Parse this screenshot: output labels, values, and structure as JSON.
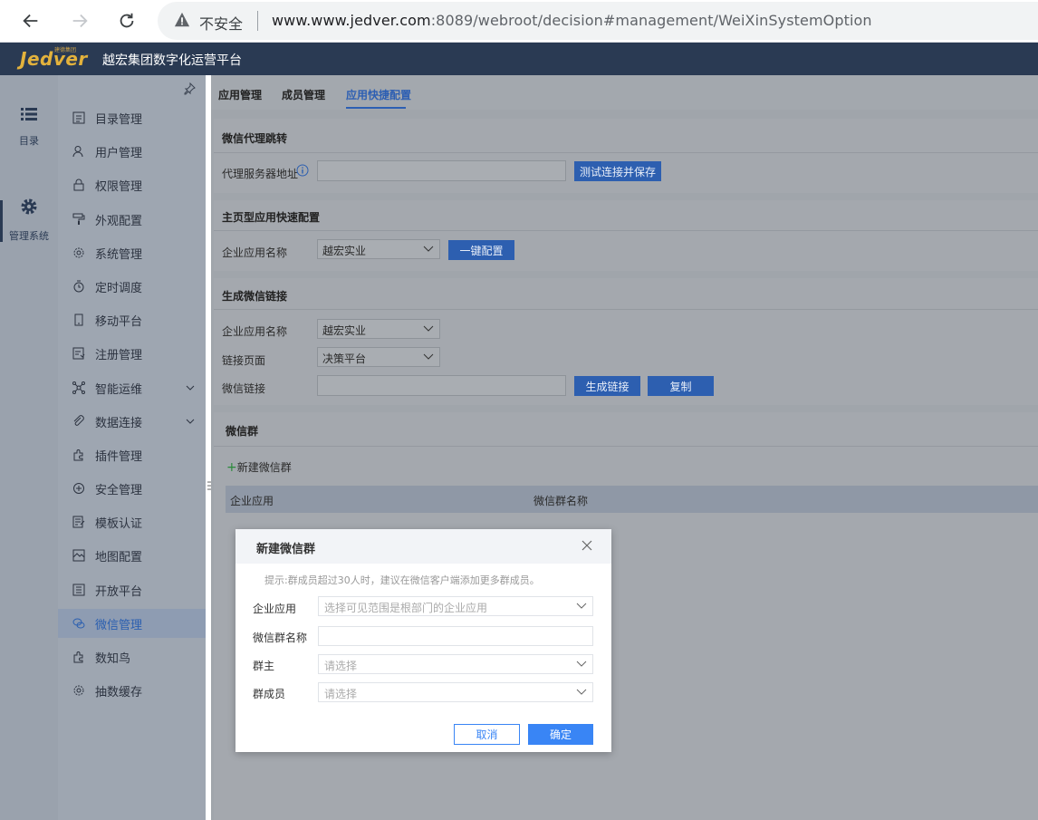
{
  "browser": {
    "insecure_label": "不安全",
    "url_host": "www.www.jedver.com",
    "url_rest": ":8089/webroot/decision#management/WeiXinSystemOption"
  },
  "app": {
    "logo": "Jedver",
    "logo_sub": "建德集团",
    "title": "越宏集团数字化运营平台"
  },
  "rail": {
    "items": [
      {
        "label": "目录",
        "icon": "list-icon"
      },
      {
        "label": "管理系统",
        "icon": "gear-icon"
      }
    ]
  },
  "menu": {
    "items": [
      {
        "label": "目录管理",
        "icon": "catalog-icon"
      },
      {
        "label": "用户管理",
        "icon": "user-icon"
      },
      {
        "label": "权限管理",
        "icon": "lock-icon"
      },
      {
        "label": "外观配置",
        "icon": "brush-icon"
      },
      {
        "label": "系统管理",
        "icon": "settings-icon"
      },
      {
        "label": "定时调度",
        "icon": "clock-icon"
      },
      {
        "label": "移动平台",
        "icon": "mobile-icon"
      },
      {
        "label": "注册管理",
        "icon": "register-icon"
      },
      {
        "label": "智能运维",
        "icon": "network-icon"
      },
      {
        "label": "数据连接",
        "icon": "link-icon"
      },
      {
        "label": "插件管理",
        "icon": "plugin-icon"
      },
      {
        "label": "安全管理",
        "icon": "shield-icon"
      },
      {
        "label": "模板认证",
        "icon": "template-icon"
      },
      {
        "label": "地图配置",
        "icon": "map-icon"
      },
      {
        "label": "开放平台",
        "icon": "open-platform-icon"
      },
      {
        "label": "微信管理",
        "icon": "wechat-icon"
      },
      {
        "label": "数知鸟",
        "icon": "bird-icon"
      },
      {
        "label": "抽数缓存",
        "icon": "cache-icon"
      }
    ]
  },
  "tabs": [
    "应用管理",
    "成员管理",
    "应用快捷配置"
  ],
  "proxy": {
    "title": "微信代理跳转",
    "label": "代理服务器地址",
    "value": "",
    "button": "测试连接并保存"
  },
  "homepage": {
    "title": "主页型应用快速配置",
    "label": "企业应用名称",
    "selected": "越宏实业",
    "button": "一键配置"
  },
  "link": {
    "title": "生成微信链接",
    "app_label": "企业应用名称",
    "app_selected": "越宏实业",
    "page_label": "链接页面",
    "page_selected": "决策平台",
    "url_label": "微信链接",
    "url_value": "",
    "gen_button": "生成链接",
    "copy_button": "复制"
  },
  "group": {
    "title": "微信群",
    "add_label": "新建微信群",
    "columns": [
      "企业应用",
      "微信群名称"
    ]
  },
  "dialog": {
    "title": "新建微信群",
    "hint": "提示:群成员超过30人时，建议在微信客户端添加更多群成员。",
    "app_label": "企业应用",
    "app_placeholder": "选择可见范围是根部门的企业应用",
    "name_label": "微信群名称",
    "name_value": "",
    "owner_label": "群主",
    "owner_placeholder": "请选择",
    "members_label": "群成员",
    "members_placeholder": "请选择",
    "cancel": "取消",
    "ok": "确定"
  }
}
